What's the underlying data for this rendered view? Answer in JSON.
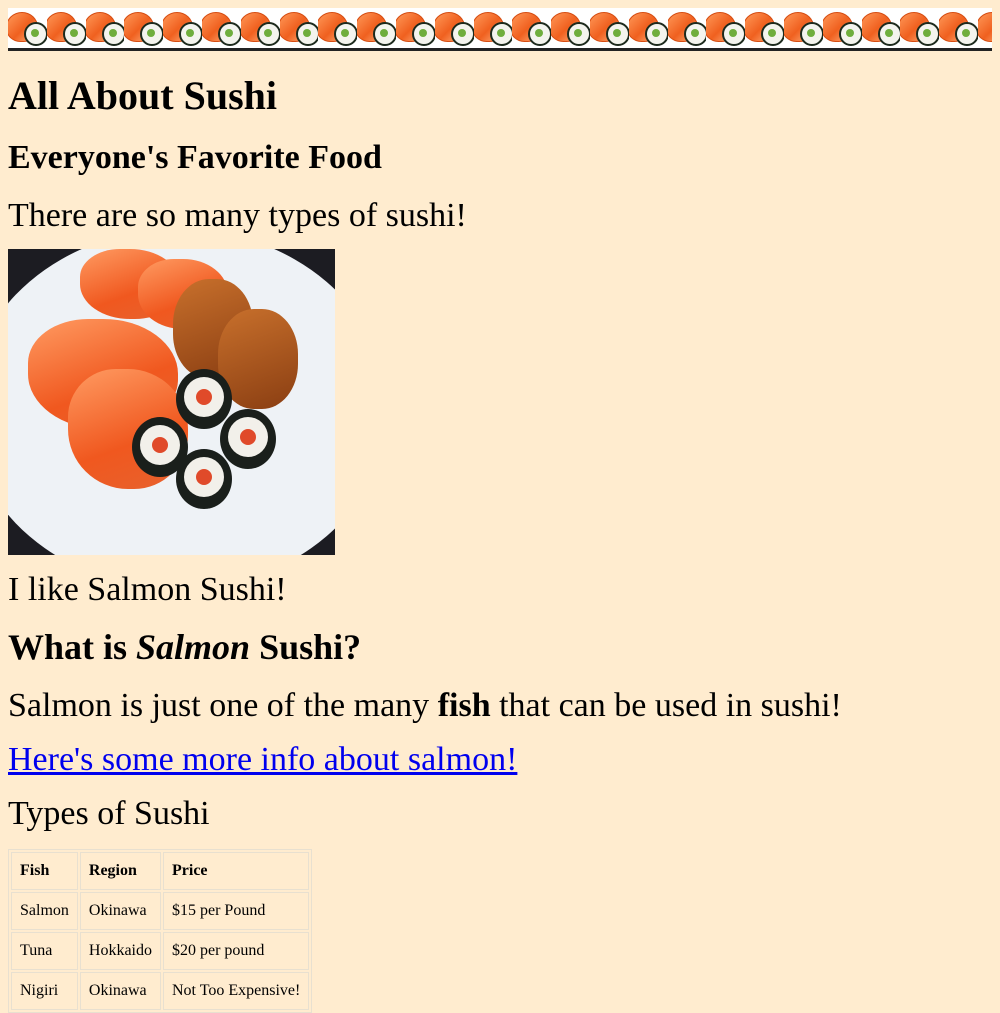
{
  "banner": {
    "roll_count": 26
  },
  "page": {
    "title": "All About Sushi",
    "subtitle": "Everyone's Favorite Food",
    "intro": "There are so many types of sushi!",
    "like_text": "I like Salmon Sushi!",
    "question_pre": "What is ",
    "question_em": "Salmon",
    "question_post": " Sushi?",
    "desc_pre": "Salmon is just one of the many ",
    "desc_bold": "fish",
    "desc_post": " that can be used in sushi!",
    "link_text": "Here's some more info about salmon!",
    "types_heading": "Types of Sushi"
  },
  "table": {
    "headers": [
      "Fish",
      "Region",
      "Price"
    ],
    "rows": [
      [
        "Salmon",
        "Okinawa",
        "$15 per Pound"
      ],
      [
        "Tuna",
        "Hokkaido",
        "$20 per pound"
      ],
      [
        "Nigiri",
        "Okinawa",
        "Not Too Expensive!"
      ]
    ]
  },
  "colors": {
    "background": "#ffeccf",
    "link": "#0000ee"
  }
}
